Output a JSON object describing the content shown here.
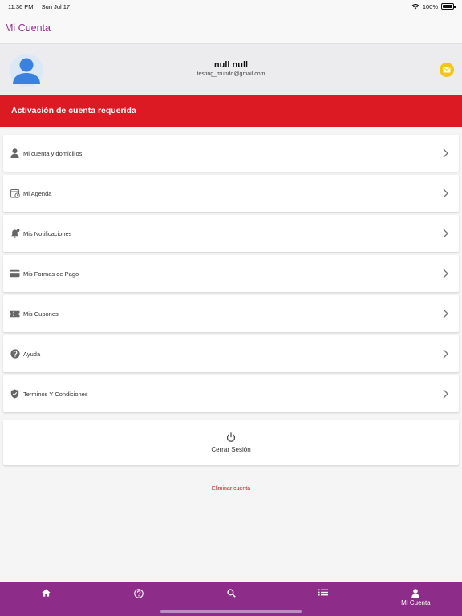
{
  "status_bar": {
    "time": "11:36 PM",
    "date": "Sun Jul 17",
    "battery": "100%"
  },
  "header": {
    "title": "Mi Cuenta"
  },
  "profile": {
    "name": "null null",
    "email": "testing_mundo@gmail.com"
  },
  "banner": {
    "text": "Activación de cuenta requerida"
  },
  "menu": {
    "items": [
      {
        "label": "Mi cuenta y domicilios",
        "icon": "person-icon"
      },
      {
        "label": "Mi Agenda",
        "icon": "calendar-clock-icon"
      },
      {
        "label": "Mis Notificaciones",
        "icon": "bell-icon"
      },
      {
        "label": "Mis Formas de Pago",
        "icon": "credit-card-icon"
      },
      {
        "label": "Mis Cupones",
        "icon": "ticket-icon"
      },
      {
        "label": "Ayuda",
        "icon": "help-icon"
      },
      {
        "label": "Terminos Y Condiciones",
        "icon": "shield-icon"
      }
    ]
  },
  "logout": {
    "label": "Cerrar Sesión"
  },
  "delete_account": {
    "label": "Eliminar cuenta"
  },
  "bottom_nav": {
    "tabs": [
      {
        "icon": "home-icon",
        "label": ""
      },
      {
        "icon": "help-icon",
        "label": ""
      },
      {
        "icon": "search-icon",
        "label": ""
      },
      {
        "icon": "list-icon",
        "label": ""
      },
      {
        "icon": "person-icon",
        "label": "Mi Cuenta"
      }
    ]
  },
  "colors": {
    "brand": "#8e2c8a",
    "alert": "#dc1a23",
    "avatar": "#3b82e0",
    "mail": "#f3c419"
  }
}
